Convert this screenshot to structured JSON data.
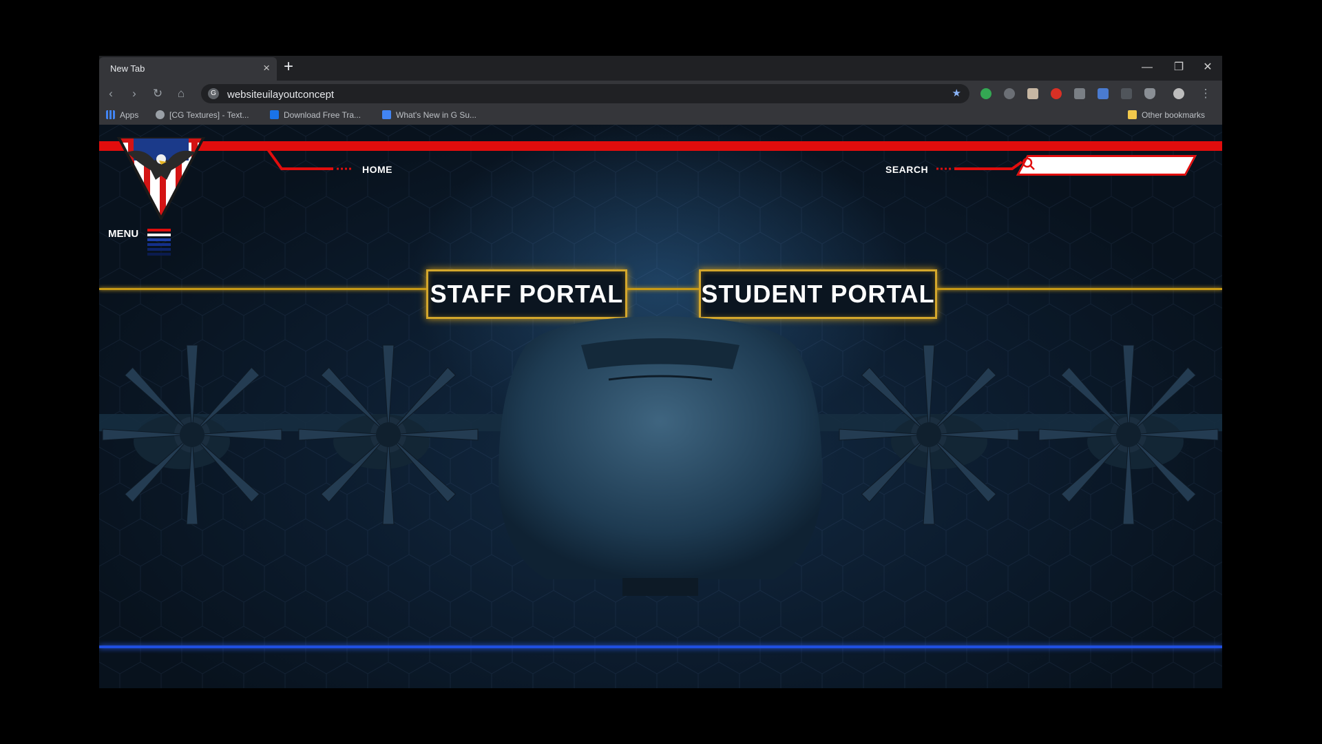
{
  "browser": {
    "tab_title": "New Tab",
    "new_tab_symbol": "+",
    "close_symbol": "×",
    "url": "websiteuilayoutconcept",
    "window_controls": {
      "minimize": "—",
      "restore": "❐",
      "close": "✕"
    },
    "bookmarks": [
      {
        "label": "Apps",
        "icon": "apps-grid-icon"
      },
      {
        "label": "[CG Textures] - Text...",
        "icon": "globe-icon"
      },
      {
        "label": "Download Free Tra...",
        "icon": "p-logo-icon"
      },
      {
        "label": "What's New in G Su...",
        "icon": "docs-icon"
      }
    ],
    "other_bookmarks": "Other bookmarks"
  },
  "site": {
    "nav": {
      "home": "HOME",
      "search": "SEARCH"
    },
    "search_value": "",
    "menu_label": "MENU",
    "portals": {
      "staff": "STAFF PORTAL",
      "student": "STUDENT PORTAL"
    }
  },
  "colors": {
    "accent_red": "#e10d0d",
    "accent_gold": "#d4a72c",
    "accent_blue": "#1f4fe0",
    "background": "#0c1c2e"
  }
}
